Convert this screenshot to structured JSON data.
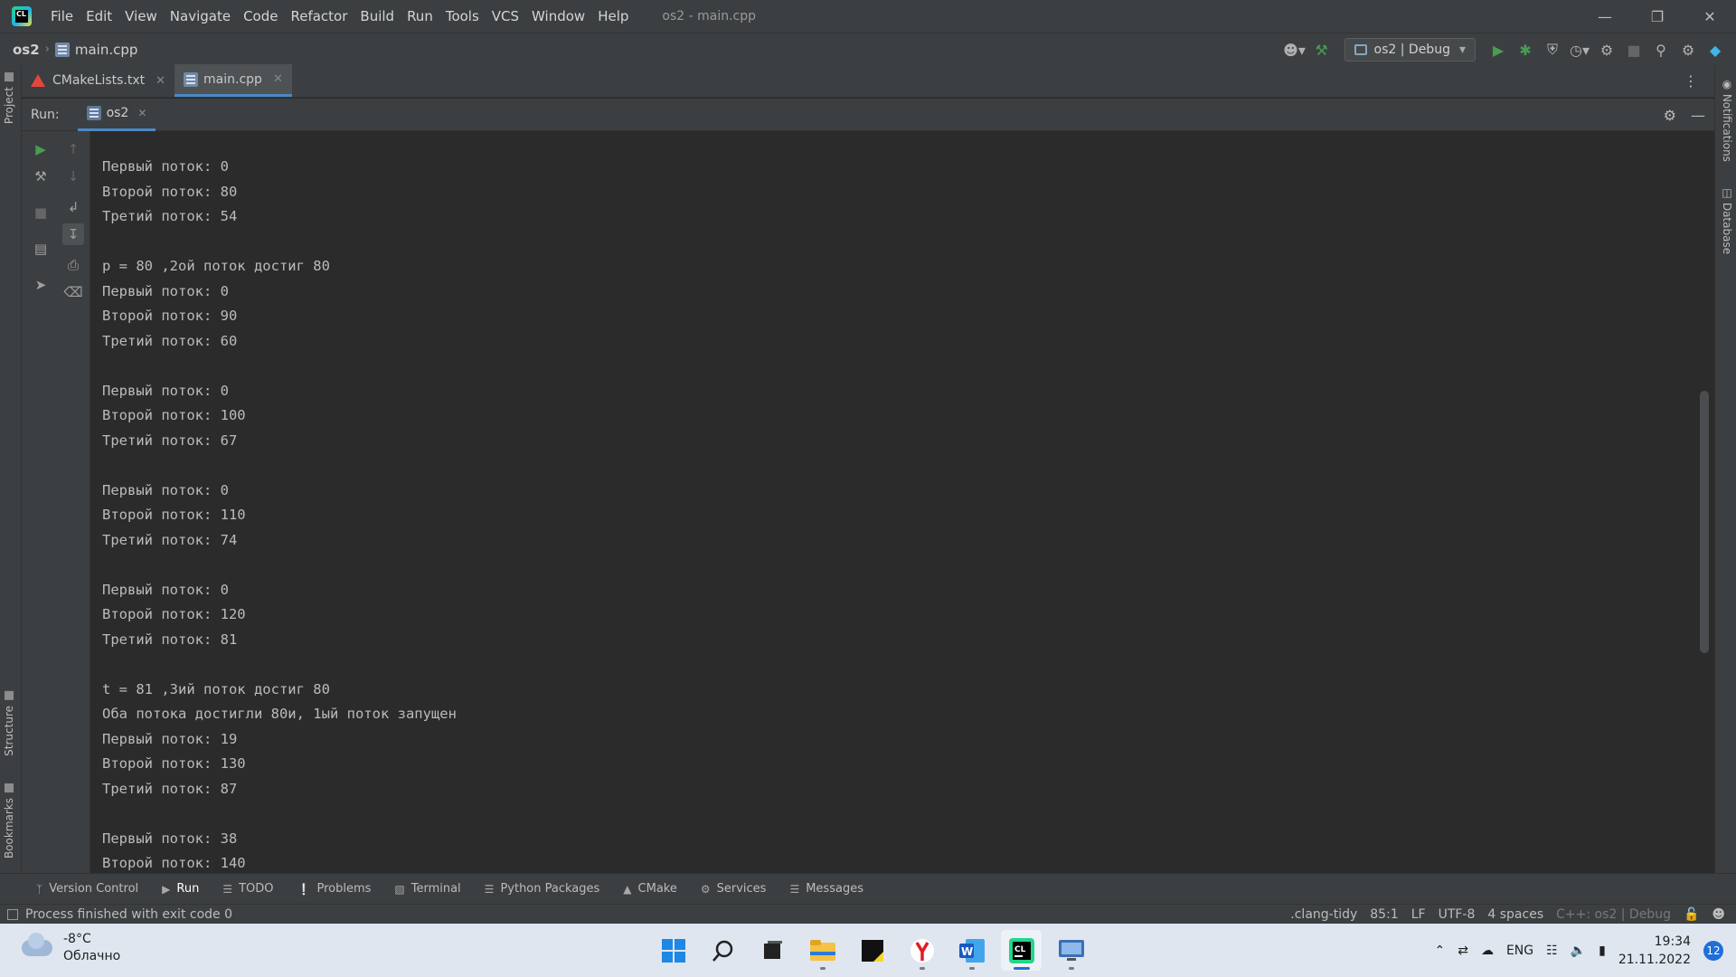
{
  "window": {
    "title": "os2 - main.cpp",
    "menu": [
      "File",
      "Edit",
      "View",
      "Navigate",
      "Code",
      "Refactor",
      "Build",
      "Run",
      "Tools",
      "VCS",
      "Window",
      "Help"
    ]
  },
  "navbar": {
    "project": "os2",
    "file": "main.cpp",
    "run_config": "os2 | Debug"
  },
  "editor_tabs": [
    {
      "label": "CMakeLists.txt",
      "active": false
    },
    {
      "label": "main.cpp",
      "active": true
    }
  ],
  "run_panel": {
    "label": "Run:",
    "tab": "os2"
  },
  "side_tabs": {
    "project": "Project",
    "structure": "Structure",
    "bookmarks": "Bookmarks",
    "notifications": "Notifications",
    "database": "Database"
  },
  "console_lines": [
    "Первый поток: 0",
    "Второй поток: 80",
    "Третий поток: 54",
    "",
    "p = 80 ,2ой поток достиг 80",
    "Первый поток: 0",
    "Второй поток: 90",
    "Третий поток: 60",
    "",
    "Первый поток: 0",
    "Второй поток: 100",
    "Третий поток: 67",
    "",
    "Первый поток: 0",
    "Второй поток: 110",
    "Третий поток: 74",
    "",
    "Первый поток: 0",
    "Второй поток: 120",
    "Третий поток: 81",
    "",
    "t = 81 ,3ий поток достиг 80",
    "Оба потока достигли 80и, 1ый поток запущен",
    "Первый поток: 19",
    "Второй поток: 130",
    "Третий поток: 87",
    "",
    "Первый поток: 38",
    "Второй поток: 140"
  ],
  "tool_tabs": [
    "Version Control",
    "Run",
    "TODO",
    "Problems",
    "Terminal",
    "Python Packages",
    "CMake",
    "Services",
    "Messages"
  ],
  "status": {
    "message": "Process finished with exit code 0",
    "linter": ".clang-tidy",
    "position": "85:1",
    "line_sep": "LF",
    "encoding": "UTF-8",
    "indent": "4 spaces",
    "context": "C++: os2 | Debug"
  },
  "taskbar": {
    "temperature": "-8°C",
    "weather": "Облачно",
    "language": "ENG",
    "time": "19:34",
    "date": "21.11.2022",
    "notifications": "12"
  },
  "colors": {
    "accent": "#4a88c7",
    "panel": "#3c3f41",
    "console_bg": "#2b2b2b",
    "run_green": "#499c54"
  }
}
